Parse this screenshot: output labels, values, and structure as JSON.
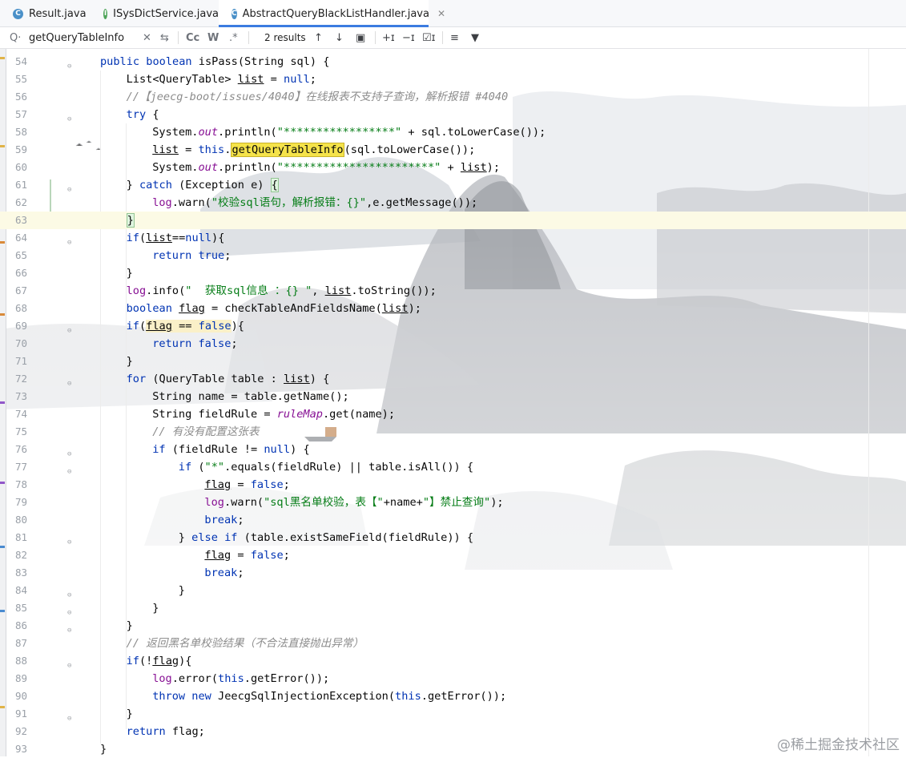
{
  "tabs": [
    {
      "label": "Result.java",
      "icon": "class-icon",
      "active": false
    },
    {
      "label": "ISysDictService.java",
      "icon": "interface-icon",
      "active": false
    },
    {
      "label": "AbstractQueryBlackListHandler.java",
      "icon": "class-icon",
      "active": true
    }
  ],
  "find": {
    "query": "getQueryTableInfo",
    "results": "2 results",
    "case_label": "Cc",
    "word_label": "W",
    "regex_label": ".*"
  },
  "watermark": "@稀土掘金技术社区",
  "lines": [
    {
      "n": "54",
      "h": "<span class=\"kw\">public boolean</span> isPass(String sql) {",
      "i": 0
    },
    {
      "n": "55",
      "h": "List&lt;QueryTable&gt; <span class=\"und\">list</span> = <span class=\"kw\">null</span>;",
      "i": 1
    },
    {
      "n": "56",
      "h": "<span class=\"cmt\">//【jeecg-boot/issues/4040】在线报表不支持子查询，解析报错 #4040</span>",
      "i": 1
    },
    {
      "n": "57",
      "h": "<span class=\"kw\">try</span> {",
      "i": 1
    },
    {
      "n": "58",
      "h": "System.<span class=\"fld\">out</span>.println(<span class=\"str\">\"*****************\"</span> + sql.toLowerCase());",
      "i": 2
    },
    {
      "n": "59",
      "h": "<span class=\"und\">list</span> = <span class=\"kw\">this</span>.<span class=\"hl\">getQueryTableInfo</span>(sql.toLowerCase());",
      "i": 2
    },
    {
      "n": "60",
      "h": "System.<span class=\"fld\">out</span>.println(<span class=\"str\">\"***********************\"</span> + <span class=\"und\">list</span>);",
      "i": 2
    },
    {
      "n": "61",
      "h": "} <span class=\"kw\">catch</span> (Exception e) <span class=\"brace\">{</span>",
      "i": 1
    },
    {
      "n": "62",
      "h": "<span class=\"lg\">log</span>.warn(<span class=\"str\">\"校验sql语句，解析报错：{}\"</span>,e.getMessage());",
      "i": 2
    },
    {
      "n": "63",
      "h": "<span class=\"brace\">}</span>",
      "i": 1,
      "cur": true
    },
    {
      "n": "64",
      "h": "<span class=\"kw\">if</span>(<span class=\"und\">list</span>==<span class=\"kw\">null</span>){",
      "i": 1
    },
    {
      "n": "65",
      "h": "<span class=\"kw\">return true</span>;",
      "i": 2
    },
    {
      "n": "66",
      "h": "}",
      "i": 1
    },
    {
      "n": "67",
      "h": "<span class=\"lg\">log</span>.info(<span class=\"str\">\"  获取sql信息 ：{} \"</span>, <span class=\"und\">list</span>.toString());",
      "i": 1
    },
    {
      "n": "68",
      "h": "<span class=\"kw\">boolean</span> <span class=\"und\">flag</span> = checkTableAndFieldsName(<span class=\"und\">list</span>);",
      "i": 1
    },
    {
      "n": "69",
      "h": "<span class=\"kw\">if</span>(<span class=\"warn\"><span class=\"und\">flag</span> == <span class=\"kw\">false</span></span>){",
      "i": 1
    },
    {
      "n": "70",
      "h": "<span class=\"kw\">return false</span>;",
      "i": 2
    },
    {
      "n": "71",
      "h": "}",
      "i": 1
    },
    {
      "n": "72",
      "h": "<span class=\"kw\">for</span> (QueryTable table : <span class=\"und\">list</span>) {",
      "i": 1
    },
    {
      "n": "73",
      "h": "String name = table.getName();",
      "i": 2
    },
    {
      "n": "74",
      "h": "String fieldRule = <span class=\"fld\">ruleMap</span>.get(name);",
      "i": 2
    },
    {
      "n": "75",
      "h": "<span class=\"cmt\">// 有没有配置这张表</span>",
      "i": 2
    },
    {
      "n": "76",
      "h": "<span class=\"kw\">if</span> (fieldRule != <span class=\"kw\">null</span>) {",
      "i": 2
    },
    {
      "n": "77",
      "h": "<span class=\"kw\">if</span> (<span class=\"str\">\"*\"</span>.equals(fieldRule) || table.isAll()) {",
      "i": 3
    },
    {
      "n": "78",
      "h": "<span class=\"und\">flag</span> = <span class=\"kw\">false</span>;",
      "i": 4
    },
    {
      "n": "79",
      "h": "<span class=\"lg\">log</span>.warn(<span class=\"str\">\"sql黑名单校验，表【\"</span>+name+<span class=\"str\">\"】禁止查询\"</span>);",
      "i": 4
    },
    {
      "n": "80",
      "h": "<span class=\"kw\">break</span>;",
      "i": 4
    },
    {
      "n": "81",
      "h": "} <span class=\"kw\">else if</span> (table.existSameField(fieldRule)) {",
      "i": 3
    },
    {
      "n": "82",
      "h": "<span class=\"und\">flag</span> = <span class=\"kw\">false</span>;",
      "i": 4
    },
    {
      "n": "83",
      "h": "<span class=\"kw\">break</span>;",
      "i": 4
    },
    {
      "n": "84",
      "h": "}",
      "i": 3
    },
    {
      "n": "85",
      "h": "}",
      "i": 2
    },
    {
      "n": "86",
      "h": "}",
      "i": 1
    },
    {
      "n": "87",
      "h": "<span class=\"cmt\">// 返回黑名单校验结果（不合法直接抛出异常）</span>",
      "i": 1
    },
    {
      "n": "88",
      "h": "<span class=\"kw\">if</span>(!<span class=\"und\">flag</span>){",
      "i": 1
    },
    {
      "n": "89",
      "h": "<span class=\"lg\">log</span>.error(<span class=\"kw\">this</span>.getError());",
      "i": 2
    },
    {
      "n": "90",
      "h": "<span class=\"kw\">throw new</span> JeecgSqlInjectionException(<span class=\"kw\">this</span>.getError());",
      "i": 2
    },
    {
      "n": "91",
      "h": "}",
      "i": 1
    },
    {
      "n": "92",
      "h": "<span class=\"kw\">return</span> flag;",
      "i": 1
    },
    {
      "n": "93",
      "h": "}",
      "i": 0
    }
  ]
}
